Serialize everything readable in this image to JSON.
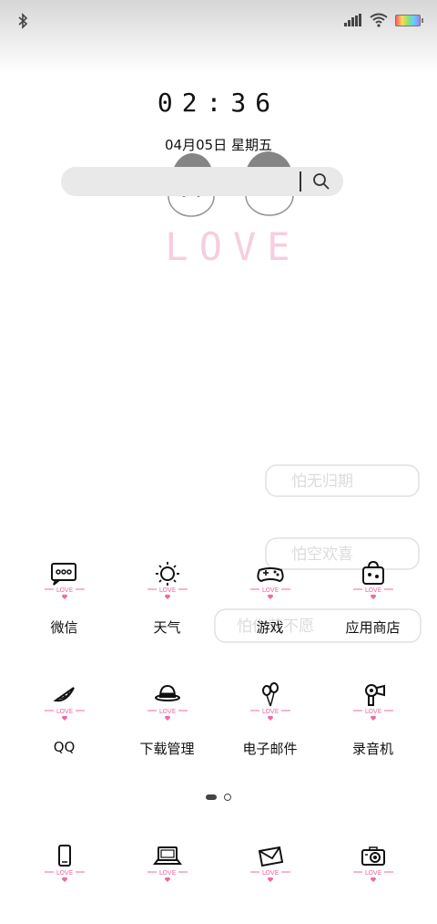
{
  "status_bar": {
    "icons": [
      "bluetooth-icon",
      "signal-icon",
      "wifi-icon",
      "battery-icon"
    ]
  },
  "lockscreen": {
    "time": "02:36",
    "date": "04月05日 星期五"
  },
  "wallpaper": {
    "heading": "LOVE",
    "bubbles": [
      "怕无归期",
      "怕空欢喜",
      "怕你若不愿"
    ]
  },
  "search": {
    "placeholder": ""
  },
  "apps": [
    {
      "label": "微信",
      "icon": "chat-bubble-icon"
    },
    {
      "label": "天气",
      "icon": "sun-icon"
    },
    {
      "label": "游戏",
      "icon": "gamepad-icon"
    },
    {
      "label": "应用商店",
      "icon": "shopping-bag-icon"
    },
    {
      "label": "QQ",
      "icon": "watermelon-icon"
    },
    {
      "label": "下载管理",
      "icon": "hat-icon"
    },
    {
      "label": "电子邮件",
      "icon": "balloons-icon"
    },
    {
      "label": "录音机",
      "icon": "hairdryer-icon"
    }
  ],
  "icon_badge_text": "LOVE",
  "dock": [
    {
      "icon": "phone-icon"
    },
    {
      "icon": "laptop-icon"
    },
    {
      "icon": "envelope-icon"
    },
    {
      "icon": "camera-icon"
    }
  ],
  "pager": {
    "pages": 2,
    "active": 0
  },
  "colors": {
    "accent_pink": "#f06aa6",
    "wallpaper_pink": "#f7cde0"
  }
}
